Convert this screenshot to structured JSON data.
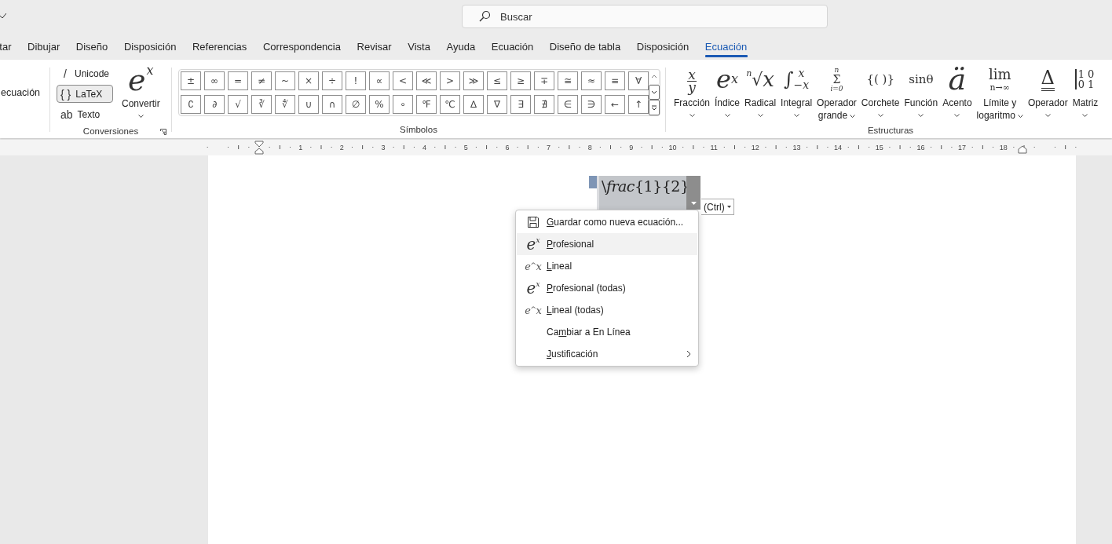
{
  "search": {
    "placeholder": "Buscar"
  },
  "tabs": [
    {
      "label": "tar",
      "selected": false
    },
    {
      "label": "Dibujar",
      "selected": false
    },
    {
      "label": "Diseño",
      "selected": false
    },
    {
      "label": "Disposición",
      "selected": false
    },
    {
      "label": "Referencias",
      "selected": false
    },
    {
      "label": "Correspondencia",
      "selected": false
    },
    {
      "label": "Revisar",
      "selected": false
    },
    {
      "label": "Vista",
      "selected": false
    },
    {
      "label": "Ayuda",
      "selected": false
    },
    {
      "label": "Ecuación",
      "selected": false
    },
    {
      "label": "Diseño de tabla",
      "selected": false
    },
    {
      "label": "Disposición",
      "selected": false
    },
    {
      "label": "Ecuación",
      "selected": true
    }
  ],
  "ribbon": {
    "partial_group": {
      "label": "ecuación"
    },
    "conversions": {
      "label": "Conversiones",
      "formats": [
        {
          "glyph": "/",
          "label": "Unicode",
          "selected": false
        },
        {
          "glyph": "{ }",
          "label": "LaTeX",
          "selected": true
        },
        {
          "glyph": "ab",
          "label": "Texto",
          "selected": false
        }
      ],
      "convert": {
        "icon": {
          "kind": "script",
          "parts": [
            "e",
            "x"
          ]
        },
        "label": "Convertir"
      }
    },
    "symbols": {
      "label": "Símbolos",
      "rows": [
        [
          "±",
          "∞",
          "=",
          "≠",
          "~",
          "×",
          "÷",
          "!",
          "∝",
          "<",
          "≪",
          ">",
          "≫",
          "≤",
          "≥",
          "∓",
          "≅",
          "≈",
          "≡",
          "∀"
        ],
        [
          "∁",
          "∂",
          "√",
          "∛",
          "∜",
          "∪",
          "∩",
          "∅",
          "%",
          "∘",
          "℉",
          "℃",
          "∆",
          "∇",
          "∃",
          "∄",
          "∈",
          "∋",
          "←",
          "↑"
        ]
      ]
    },
    "structures": {
      "label": "Estructuras",
      "items": [
        {
          "icon": {
            "kind": "fraction",
            "parts": [
              "x",
              "y"
            ]
          },
          "label_lines": [
            "Fracción"
          ]
        },
        {
          "icon": {
            "kind": "script",
            "parts": [
              "e",
              "x"
            ]
          },
          "label_lines": [
            "Índice"
          ]
        },
        {
          "icon": {
            "kind": "radical",
            "parts": [
              "n",
              "√",
              "x"
            ]
          },
          "label_lines": [
            "Radical"
          ]
        },
        {
          "icon": {
            "kind": "integral",
            "parts": [
              "∫",
              "x",
              "−x"
            ]
          },
          "label_lines": [
            "Integral"
          ]
        },
        {
          "icon": {
            "kind": "bigop",
            "parts": [
              "n",
              "Σ",
              "i=0"
            ]
          },
          "label_lines": [
            "Operador",
            "grande"
          ]
        },
        {
          "icon": {
            "kind": "plain",
            "parts": [
              "{( )}"
            ]
          },
          "label_lines": [
            "Corchete"
          ]
        },
        {
          "icon": {
            "kind": "plain",
            "parts": [
              "sinθ"
            ]
          },
          "label_lines": [
            "Función"
          ]
        },
        {
          "icon": {
            "kind": "big",
            "parts": [
              "ä"
            ]
          },
          "label_lines": [
            "Acento"
          ]
        },
        {
          "icon": {
            "kind": "stack",
            "parts": [
              "lim",
              "n→∞"
            ]
          },
          "label_lines": [
            "Límite y",
            "logaritmo"
          ]
        },
        {
          "icon": {
            "kind": "underbar",
            "parts": [
              "Δ"
            ]
          },
          "label_lines": [
            "Operador"
          ]
        },
        {
          "icon": {
            "kind": "matrix",
            "parts": [
              "1 0",
              "0 1"
            ]
          },
          "label_lines": [
            "Matriz"
          ]
        }
      ]
    }
  },
  "ruler": {
    "numbers": [
      "1",
      "2",
      "3",
      "4",
      "5",
      "6",
      "7",
      "8",
      "9",
      "10",
      "11",
      "12",
      "13",
      "14",
      "15",
      "16",
      "17",
      "18"
    ]
  },
  "document": {
    "equation": {
      "text": "\\*frac*{1}{2}"
    },
    "paste_options": {
      "label": "(Ctrl)"
    },
    "menu": [
      {
        "icon": {
          "kind": "save"
        },
        "key": "G",
        "post": "uardar como nueva ecuación...",
        "highlighted": false,
        "submenu": false
      },
      {
        "icon": {
          "kind": "script",
          "parts": [
            "e",
            "x"
          ]
        },
        "key": "P",
        "post": "rofesional",
        "highlighted": true,
        "submenu": false
      },
      {
        "icon": {
          "kind": "linear",
          "parts": [
            "e",
            "^",
            "x"
          ]
        },
        "key": "L",
        "post": "ineal",
        "highlighted": false,
        "submenu": false
      },
      {
        "icon": {
          "kind": "script",
          "parts": [
            "e",
            "x"
          ]
        },
        "key": "P",
        "post": "rofesional (todas)",
        "highlighted": false,
        "submenu": false
      },
      {
        "icon": {
          "kind": "linear",
          "parts": [
            "e",
            "^",
            "x"
          ]
        },
        "key": "L",
        "post": "ineal (todas)",
        "highlighted": false,
        "submenu": false
      },
      {
        "pre": "Ca",
        "key": "m",
        "post": "biar a En Línea",
        "highlighted": false,
        "submenu": false
      },
      {
        "key": "J",
        "post": "ustificación",
        "highlighted": false,
        "submenu": true
      }
    ]
  }
}
